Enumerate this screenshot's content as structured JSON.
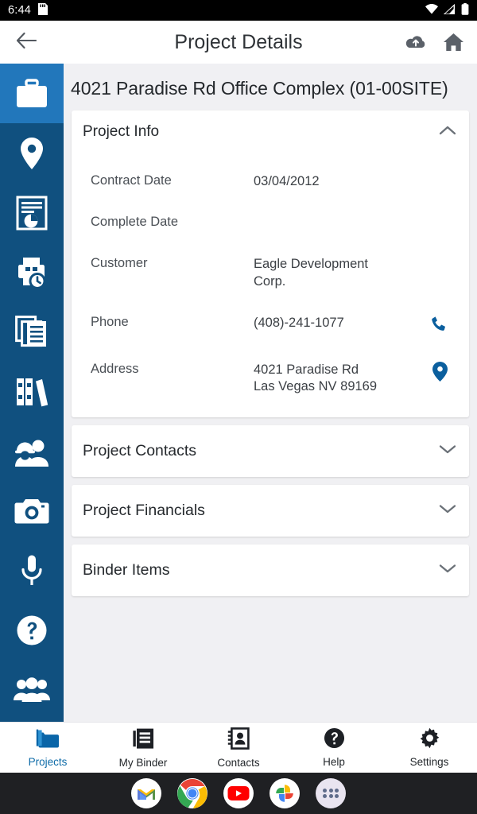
{
  "statusbar": {
    "time": "6:44",
    "icons": [
      "sd-card-icon",
      "wifi-icon",
      "cellular-signal-icon",
      "battery-icon"
    ]
  },
  "appbar": {
    "title": "Project Details",
    "back_icon": "back-arrow-icon",
    "sync_icon": "cloud-upload-icon",
    "home_icon": "home-icon"
  },
  "sidebar": {
    "items": [
      {
        "name": "briefcase-icon",
        "active": true
      },
      {
        "name": "map-pin-icon",
        "active": false
      },
      {
        "name": "report-chart-icon",
        "active": false
      },
      {
        "name": "print-history-icon",
        "active": false
      },
      {
        "name": "documents-copy-icon",
        "active": false
      },
      {
        "name": "binders-icon",
        "active": false
      },
      {
        "name": "crew-hardhat-icon",
        "active": false
      },
      {
        "name": "camera-icon",
        "active": false
      },
      {
        "name": "microphone-icon",
        "active": false
      },
      {
        "name": "help-circle-icon",
        "active": false
      },
      {
        "name": "people-group-icon",
        "active": false
      }
    ]
  },
  "main": {
    "project_title": "4021 Paradise Rd Office Complex  (01-00SITE)",
    "sections": [
      {
        "title": "Project Info",
        "expanded": true
      },
      {
        "title": "Project Contacts",
        "expanded": false
      },
      {
        "title": "Project Financials",
        "expanded": false
      },
      {
        "title": "Binder Items",
        "expanded": false
      }
    ],
    "project_info": {
      "fields": [
        {
          "label": "Contract Date",
          "value": "03/04/2012",
          "action": ""
        },
        {
          "label": "Complete Date",
          "value": "",
          "action": ""
        },
        {
          "label": "Customer",
          "value": "Eagle Development\nCorp.",
          "action": ""
        },
        {
          "label": "Phone",
          "value": "(408)-241-1077",
          "action": "phone-icon"
        },
        {
          "label": "Address",
          "value": "4021 Paradise Rd\nLas Vegas NV 89169",
          "action": "map-pin-icon"
        }
      ]
    }
  },
  "bottomnav": {
    "items": [
      {
        "label": "Projects",
        "icon": "folder-icon",
        "active": true
      },
      {
        "label": "My Binder",
        "icon": "binder-document-icon",
        "active": false
      },
      {
        "label": "Contacts",
        "icon": "address-book-icon",
        "active": false
      },
      {
        "label": "Help",
        "icon": "help-circle-icon",
        "active": false
      },
      {
        "label": "Settings",
        "icon": "gear-icon",
        "active": false
      }
    ]
  },
  "dock": {
    "apps": [
      "gmail-icon",
      "chrome-icon",
      "youtube-icon",
      "google-photos-icon",
      "app-drawer-icon"
    ]
  },
  "colors": {
    "rail": "#10507f",
    "rail_active": "#2277bb",
    "accent": "#0d6ba8",
    "action_blue": "#0b5f9e",
    "content_bg": "#f0f0f3"
  }
}
